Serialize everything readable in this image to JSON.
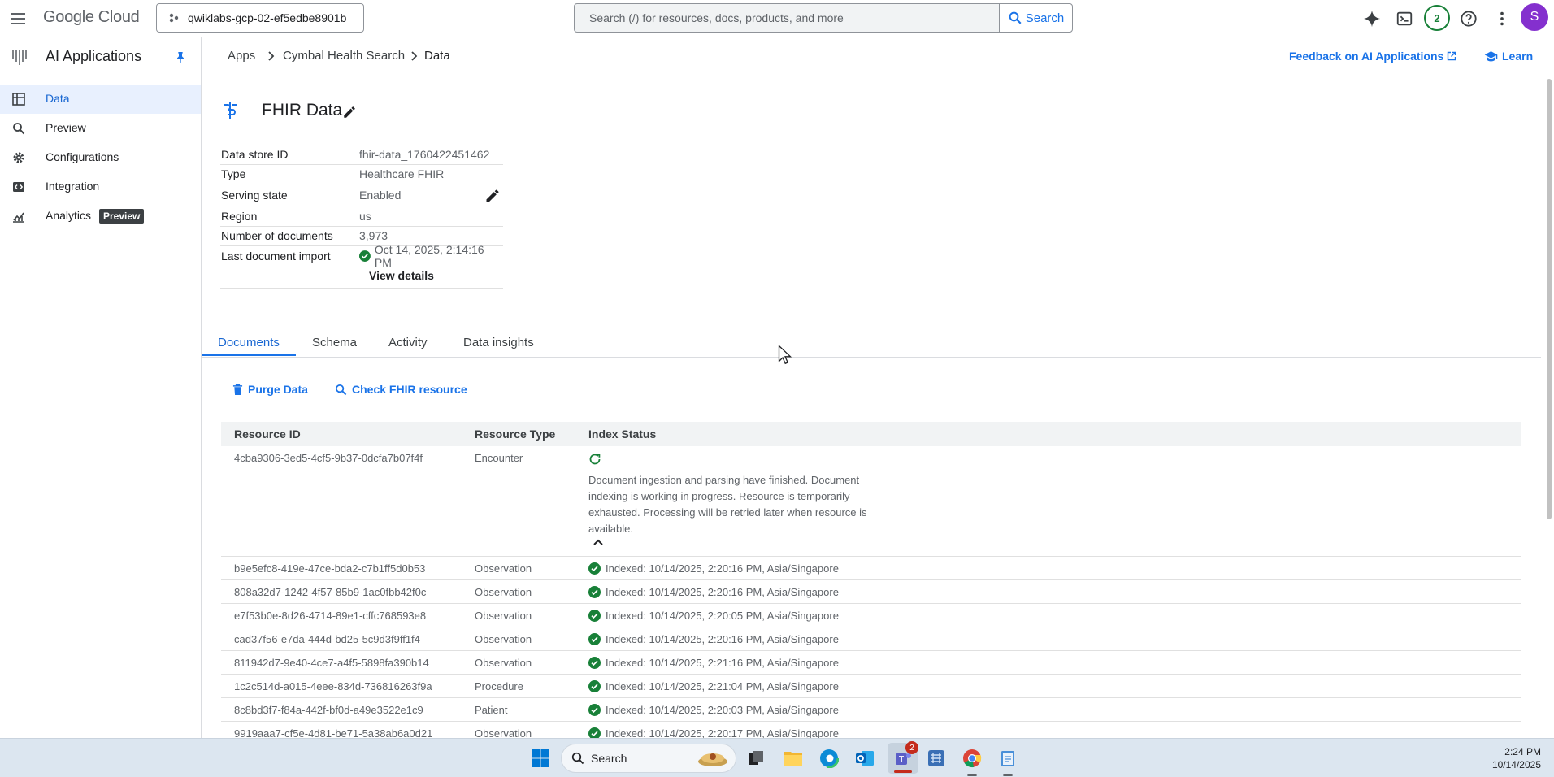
{
  "topbar": {
    "logo_google": "Google",
    "logo_cloud": "Cloud",
    "project": "qwiklabs-gcp-02-ef5edbe8901b",
    "search_placeholder": "Search (/) for resources, docs, products, and more",
    "search_label": "Search",
    "notifications_count": "2",
    "avatar_initial": "S"
  },
  "sidebar": {
    "title": "AI Applications",
    "items": [
      {
        "label": "Data",
        "icon": "grid-icon",
        "active": true
      },
      {
        "label": "Preview",
        "icon": "search-icon"
      },
      {
        "label": "Configurations",
        "icon": "gear-icon"
      },
      {
        "label": "Integration",
        "icon": "code-icon"
      },
      {
        "label": "Analytics",
        "icon": "analytics-icon",
        "chip": "Preview"
      }
    ]
  },
  "breadcrumb": {
    "items": [
      "Apps",
      "Cymbal Health Search",
      "Data"
    ],
    "feedback": "Feedback on AI Applications",
    "learn": "Learn"
  },
  "datastore": {
    "title": "FHIR Data",
    "properties": [
      {
        "key": "Data store ID",
        "value": "fhir-data_1760422451462"
      },
      {
        "key": "Type",
        "value": "Healthcare FHIR"
      },
      {
        "key": "Serving state",
        "value": "Enabled"
      },
      {
        "key": "Region",
        "value": "us"
      },
      {
        "key": "Number of documents",
        "value": "3,973"
      },
      {
        "key": "Last document import",
        "value": "Oct 14, 2025, 2:14:16 PM"
      }
    ],
    "view_details": "View details"
  },
  "tabs": [
    "Documents",
    "Schema",
    "Activity",
    "Data insights"
  ],
  "actions": {
    "purge": "Purge Data",
    "check": "Check FHIR resource"
  },
  "table": {
    "headers": [
      "Resource ID",
      "Resource Type",
      "Index Status"
    ],
    "expanded_row": {
      "id": "4cba9306-3ed5-4cf5-9b37-0dcfa7b07f4f",
      "type": "Encounter",
      "status": "Document ingestion and parsing have finished. Document indexing is working in progress. Resource is temporarily exhausted. Processing will be retried later when resource is available."
    },
    "rows": [
      {
        "id": "b9e5efc8-419e-47ce-bda2-c7b1ff5d0b53",
        "type": "Observation",
        "status": "Indexed: 10/14/2025, 2:20:16 PM, Asia/Singapore"
      },
      {
        "id": "808a32d7-1242-4f57-85b9-1ac0fbb42f0c",
        "type": "Observation",
        "status": "Indexed: 10/14/2025, 2:20:16 PM, Asia/Singapore"
      },
      {
        "id": "e7f53b0e-8d26-4714-89e1-cffc768593e8",
        "type": "Observation",
        "status": "Indexed: 10/14/2025, 2:20:05 PM, Asia/Singapore"
      },
      {
        "id": "cad37f56-e7da-444d-bd25-5c9d3f9ff1f4",
        "type": "Observation",
        "status": "Indexed: 10/14/2025, 2:20:16 PM, Asia/Singapore"
      },
      {
        "id": "811942d7-9e40-4ce7-a4f5-5898fa390b14",
        "type": "Observation",
        "status": "Indexed: 10/14/2025, 2:21:16 PM, Asia/Singapore"
      },
      {
        "id": "1c2c514d-a015-4eee-834d-736816263f9a",
        "type": "Procedure",
        "status": "Indexed: 10/14/2025, 2:21:04 PM, Asia/Singapore"
      },
      {
        "id": "8c8bd3f7-f84a-442f-bf0d-a49e3522e1c9",
        "type": "Patient",
        "status": "Indexed: 10/14/2025, 2:20:03 PM, Asia/Singapore"
      },
      {
        "id": "9919aaa7-cf5e-4d81-be71-5a38ab6a0d21",
        "type": "Observation",
        "status": "Indexed: 10/14/2025, 2:20:17 PM, Asia/Singapore"
      }
    ]
  },
  "taskbar": {
    "search_label": "Search",
    "teams_badge": "2",
    "time": "2:24 PM",
    "date": "10/14/2025"
  },
  "colors": {
    "accent": "#1a73e8",
    "success": "#188038",
    "avatar": "#8430ce"
  }
}
